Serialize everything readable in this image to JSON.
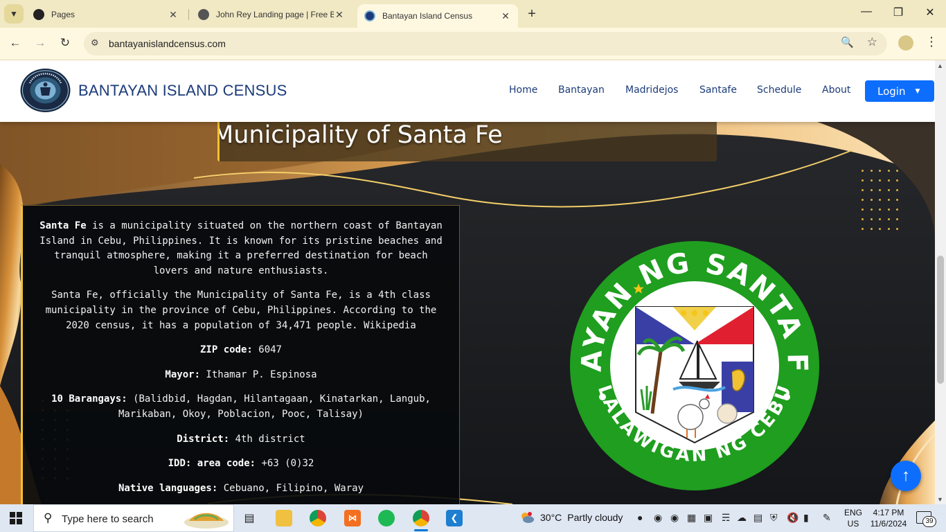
{
  "browser": {
    "tabs": [
      {
        "title": "Pages",
        "icon": "github-icon"
      },
      {
        "title": "John Rey Landing page | Free B",
        "icon": "globe-icon"
      },
      {
        "title": "Bantayan Island Census",
        "icon": "site-favicon",
        "active": true
      }
    ],
    "url": "bantayanislandcensus.com"
  },
  "site": {
    "brand": "BANTAYAN ISLAND CENSUS",
    "nav": [
      "Home",
      "Bantayan",
      "Madridejos",
      "Santafe",
      "Schedule",
      "About"
    ],
    "login_label": "Login",
    "hero_heading": "Municipality of Santa Fe",
    "intro_bold": "Santa Fe",
    "intro_rest": " is a municipality situated on the northern coast of Bantayan Island in Cebu, Philippines. It is known for its pristine beaches and tranquil atmosphere, making it a preferred destination for beach lovers and nature enthusiasts.",
    "description": "Santa Fe, officially the Municipality of Santa Fe, is a 4th class municipality in the province of Cebu, Philippines. According to the 2020 census, it has a population of 34,471 people. Wikipedia",
    "facts": [
      {
        "label": "ZIP code:",
        "value": " 6047"
      },
      {
        "label": "Mayor:",
        "value": " Ithamar P. Espinosa"
      },
      {
        "label": "10 Barangays:",
        "value": " (Balidbid, Hagdan, Hilantagaan, Kinatarkan, Langub, Marikaban, Okoy, Poblacion, Pooc, Talisay)"
      },
      {
        "label": "District:",
        "value": " 4th district"
      },
      {
        "label": "IDD: area code:",
        "value": " +63 (0)32"
      },
      {
        "label": "Native languages:",
        "value": " Cebuano, Filipino, Waray"
      }
    ],
    "seal": {
      "top_text": "BAYAN NG SANTA FE",
      "bottom_text": "LALAWIGAN NG CEBU"
    },
    "logo_text": {
      "top": "BANTAYAN ISLAND CENSUS",
      "bottom": "WITH LORAINE"
    }
  },
  "taskbar": {
    "search_placeholder": "Type here to search",
    "weather": {
      "temp": "30°C",
      "condition": "Partly cloudy"
    },
    "language": {
      "line1": "ENG",
      "line2": "US"
    },
    "clock": {
      "time": "4:17 PM",
      "date": "11/6/2024"
    },
    "notifications": "39",
    "pinned": [
      "task-view-icon",
      "file-explorer-icon",
      "chrome-icon",
      "xampp-icon",
      "spotify-icon",
      "chrome-profile-icon",
      "vscode-icon"
    ]
  },
  "colors": {
    "accent": "#0d6efd",
    "brand": "#1b3b7a",
    "gold": "#f1c232",
    "seal_green": "#1f9e1f"
  }
}
